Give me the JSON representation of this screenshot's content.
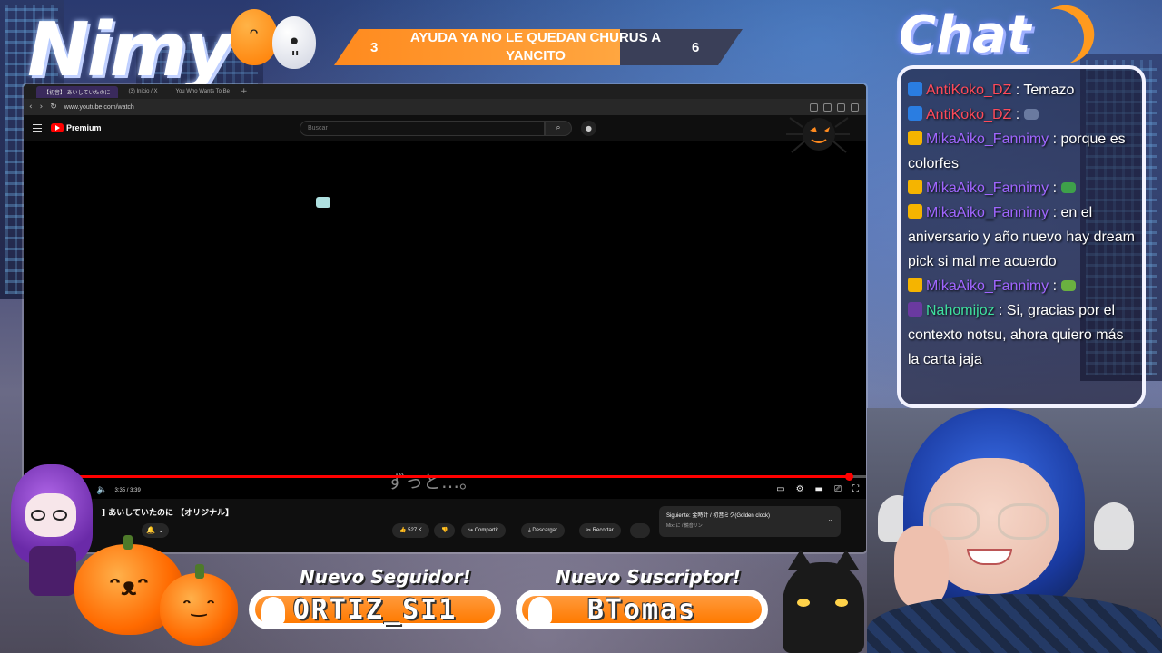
{
  "overlay": {
    "logo_text": "Nimy",
    "banner": {
      "left_number": "3",
      "text": "AYUDA YA NO LE QUEDAN CHURUS A YANCITO",
      "right_number": "6"
    },
    "chat_title": "Chat"
  },
  "browser": {
    "tabs": [
      {
        "label": "【初音】 あいしていたのに",
        "active": true
      },
      {
        "label": "(3) Inicio / X",
        "active": false
      },
      {
        "label": "You Who Wants To Be",
        "active": false
      }
    ],
    "new_tab_icon": "+",
    "url": "www.youtube.com/watch"
  },
  "youtube": {
    "brand": "Premium",
    "search_placeholder": "Buscar",
    "player": {
      "time": "3:35 / 3:39",
      "progress": 0.98,
      "subtitle": "ずっと…。"
    },
    "video_title": "] あいしていたのに 【オリジナル】",
    "actions": {
      "likes": "527 K",
      "share": "Compartir",
      "download": "Descargar",
      "clip": "Recortar",
      "more": "…"
    },
    "next": {
      "title": "Siguiente: 金時計 / 初音ミク(Golden clock)",
      "subtitle": "Mix: に / 鏡音リン"
    }
  },
  "chat": {
    "messages": [
      {
        "user": "AntiKoko_DZ",
        "text": " : Temazo",
        "color": "#ff4a5a",
        "badge": "#2a7de1"
      },
      {
        "user": "AntiKoko_DZ",
        "text": " : ",
        "color": "#ff4a5a",
        "badge": "#2a7de1",
        "emote": "#6a7aa0"
      },
      {
        "user": "MikaAiko_Fannimy",
        "text": " : porque es colorfes",
        "color": "#a066ff",
        "badge": "#f5b400"
      },
      {
        "user": "MikaAiko_Fannimy",
        "text": " : ",
        "color": "#a066ff",
        "badge": "#f5b400",
        "emote": "#3ea04a"
      },
      {
        "user": "MikaAiko_Fannimy",
        "text": " : en el aniversario y año nuevo hay dream pick si mal me acuerdo",
        "color": "#a066ff",
        "badge": "#f5b400"
      },
      {
        "user": "MikaAiko_Fannimy",
        "text": " : ",
        "color": "#a066ff",
        "badge": "#f5b400",
        "emote": "#6ab040"
      },
      {
        "user": "Nahomijoz",
        "text": " : Si, gracias por el contexto notsu, ahora quiero más la carta jaja",
        "color": "#3fe0a0",
        "badge": "#6a3aa0"
      }
    ]
  },
  "alerts": {
    "follower_label": "Nuevo Seguidor!",
    "follower_name": "ORTIZ_SI1",
    "subscriber_label": "Nuevo Suscriptor!",
    "subscriber_name": "BTomas"
  },
  "colors": {
    "accent_orange": "#ff8a1e",
    "youtube_red": "#ff0000",
    "chat_border": "#f3f3ff"
  }
}
